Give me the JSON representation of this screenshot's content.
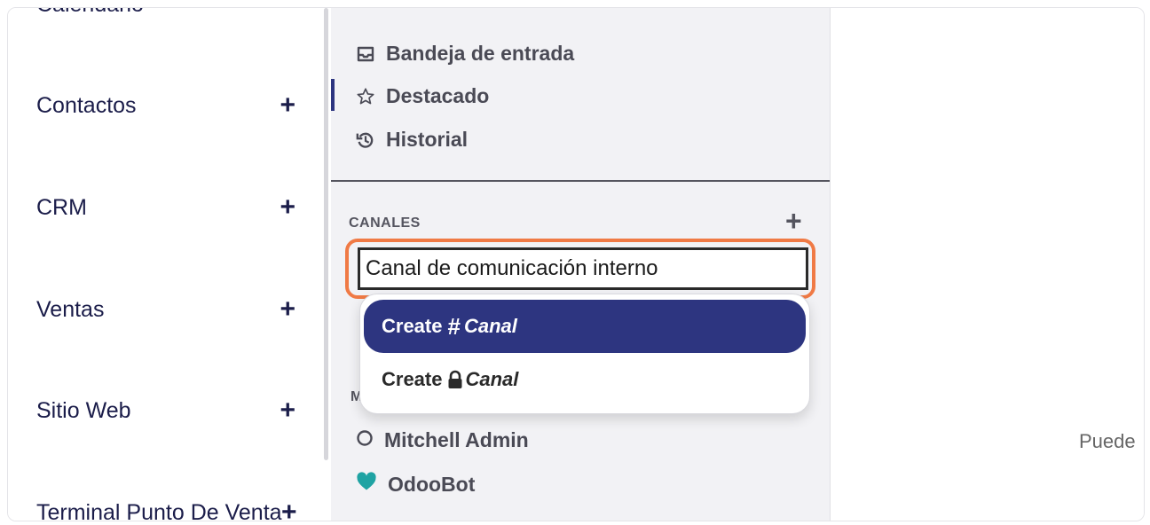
{
  "app_menu": {
    "top_partial": "Calendario",
    "items": [
      {
        "label": "Contactos",
        "add": "+"
      },
      {
        "label": "CRM",
        "add": "+"
      },
      {
        "label": "Ventas",
        "add": "+"
      },
      {
        "label": "Sitio Web",
        "add": "+"
      },
      {
        "label": "Terminal Punto De Venta",
        "add": "+"
      }
    ]
  },
  "discuss": {
    "nav": [
      {
        "label": "Bandeja de entrada",
        "icon": "inbox-icon"
      },
      {
        "label": "Destacado",
        "icon": "star-icon"
      },
      {
        "label": "Historial",
        "icon": "history-icon"
      }
    ],
    "channels": {
      "title": "CANALES",
      "add": "+",
      "input_value": "Canal de comunicación interno"
    },
    "dropdown": {
      "items": [
        {
          "prefix": "Create",
          "symbol": "#",
          "name": "Canal"
        },
        {
          "prefix": "Create",
          "symbol": "lock-icon",
          "name": "Canal"
        }
      ]
    },
    "dm_section_letter": "M",
    "direct_messages": [
      {
        "label": "Mitchell Admin",
        "icon": "status-circle-icon"
      },
      {
        "label": "OdooBot",
        "icon": "heart-icon"
      }
    ]
  },
  "main": {
    "partial_text": "Puede"
  },
  "colors": {
    "accent": "#2d3580",
    "highlight": "#f07a45",
    "heart": "#1fa3a3"
  }
}
